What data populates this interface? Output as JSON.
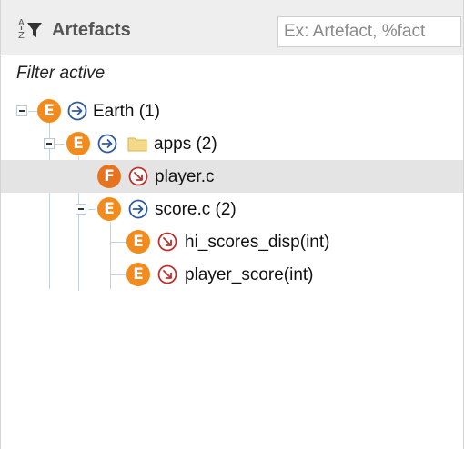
{
  "header": {
    "title": "Artefacts",
    "sort_icon": "sort-az-filter-icon",
    "search_placeholder": "Ex: Artefact, %fact"
  },
  "filter_status": "Filter active",
  "tree": [
    {
      "label": "Earth (1)",
      "badge": "E",
      "arrow": "in",
      "depth": 0,
      "expanded": true
    },
    {
      "label": "apps (2)",
      "badge": "E",
      "arrow": "in",
      "folder": true,
      "depth": 1,
      "expanded": true
    },
    {
      "label": "player.c",
      "badge": "F",
      "arrow": "out",
      "depth": 2,
      "selected": true
    },
    {
      "label": "score.c (2)",
      "badge": "E",
      "arrow": "in",
      "depth": 2,
      "expanded": true
    },
    {
      "label": "hi_scores_disp(int)",
      "badge": "E",
      "arrow": "out",
      "depth": 3
    },
    {
      "label": "player_score(int)",
      "badge": "E",
      "arrow": "out",
      "depth": 3
    }
  ],
  "colors": {
    "badge_e": "#f28b1b",
    "badge_f": "#e8731f",
    "arrow_in": "#2f5b9a",
    "arrow_out": "#b8322f",
    "selected_row": "#e4e4e4"
  }
}
